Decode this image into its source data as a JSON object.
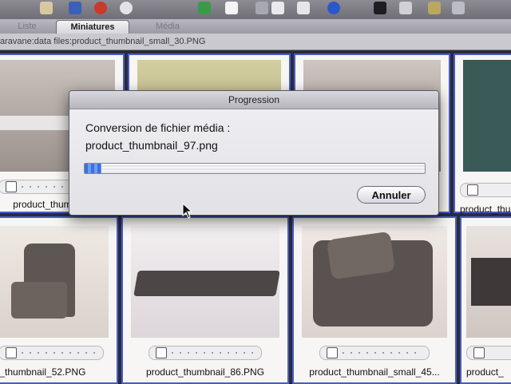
{
  "tabs": [
    {
      "label": "Liste"
    },
    {
      "label": "Miniatures"
    },
    {
      "label": "Média"
    }
  ],
  "pathbar": {
    "text": "aravane:data files:product_thumbnail_small_30.PNG"
  },
  "grid": {
    "top_row_labels": [
      "product_thumbnail_s",
      "",
      "",
      "product_thum"
    ],
    "bottom_row_labels": [
      "t_thumbnail_52.PNG",
      "product_thumbnail_86.PNG",
      "product_thumbnail_small_45...",
      "product_"
    ]
  },
  "dialog": {
    "title": "Progression",
    "message_line1": "Conversion de fichier média :",
    "message_line2": "product_thumbnail_97.png",
    "progress_fraction": 0.05,
    "cancel_label": "Annuler"
  },
  "colors": {
    "selection_border": "#4a5cc8",
    "progress_accent": "#3d6fe0"
  }
}
